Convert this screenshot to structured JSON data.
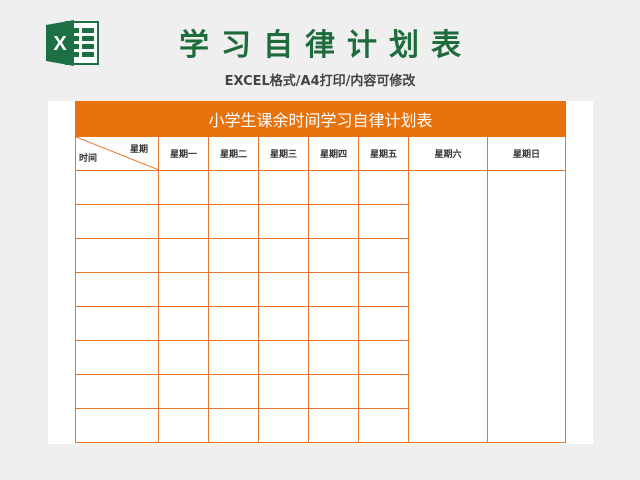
{
  "page": {
    "title": "学习自律计划表",
    "subtitle": "EXCEL格式/A4打印/内容可修改",
    "logo_letter": "X"
  },
  "colors": {
    "title_green": "#1e6b3b",
    "accent_orange": "#e8720e",
    "excel_green": "#1d7044"
  },
  "table": {
    "title": "小学生课余时间学习自律计划表",
    "corner_top": "星期",
    "corner_bottom": "时间",
    "days": [
      "星期一",
      "星期二",
      "星期三",
      "星期四",
      "星期五",
      "星期六",
      "星期日"
    ],
    "body_row_count": 8
  }
}
